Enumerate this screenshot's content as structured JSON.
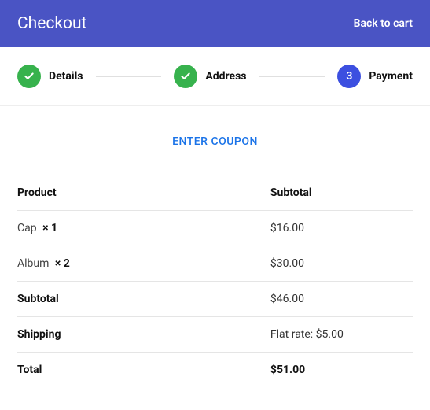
{
  "header": {
    "title": "Checkout",
    "back": "Back to cart"
  },
  "steps": {
    "s1": {
      "label": "Details"
    },
    "s2": {
      "label": "Address"
    },
    "s3": {
      "num": "3",
      "label": "Payment"
    }
  },
  "coupon": {
    "label": "ENTER COUPON"
  },
  "table": {
    "head_product": "Product",
    "head_subtotal": "Subtotal",
    "items": [
      {
        "name": "Cap",
        "qty": "× 1",
        "subtotal": "$16.00"
      },
      {
        "name": "Album",
        "qty": "× 2",
        "subtotal": "$30.00"
      }
    ],
    "subtotal_label": "Subtotal",
    "subtotal_value": "$46.00",
    "shipping_label": "Shipping",
    "shipping_value": "Flat rate: $5.00",
    "total_label": "Total",
    "total_value": "$51.00"
  }
}
